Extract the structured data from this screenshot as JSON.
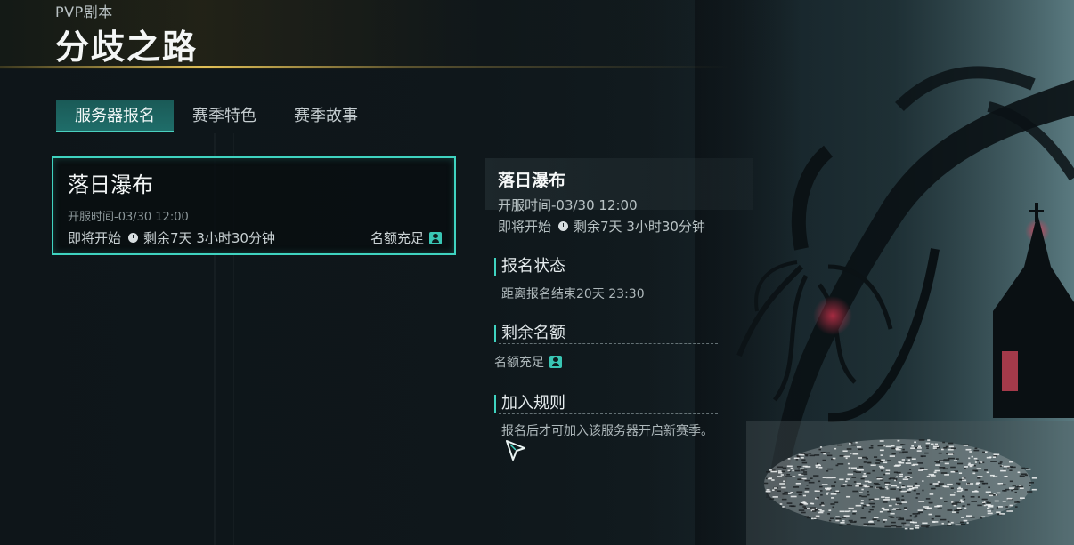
{
  "header": {
    "subtitle": "PVP剧本",
    "title": "分歧之路"
  },
  "tabs": [
    {
      "label": "服务器报名",
      "active": true
    },
    {
      "label": "赛季特色",
      "active": false
    },
    {
      "label": "赛季故事",
      "active": false
    }
  ],
  "server_card": {
    "name": "落日瀑布",
    "open_time": "开服时间-03/30 12:00",
    "status": "即将开始",
    "remaining": "剩余7天 3小时30分钟",
    "quota": "名额充足",
    "selected": true
  },
  "detail": {
    "name": "落日瀑布",
    "open_time": "开服时间-03/30 12:00",
    "status": "即将开始",
    "remaining": "剩余7天 3小时30分钟",
    "sections": [
      {
        "heading": "报名状态",
        "text": "距离报名结束20天 23:30"
      },
      {
        "heading": "剩余名额",
        "text": "名额充足"
      },
      {
        "heading": "加入规则",
        "text": "报名后才可加入该服务器开启新赛季。"
      }
    ]
  },
  "icons": {
    "clock": "clock-icon",
    "quota": "person-badge-icon",
    "cursor": "arrow-cursor-icon"
  },
  "colors": {
    "accent": "#3fd3c0",
    "tab_active_bg": "#1f6d69",
    "gold_line": "#ebc85a"
  }
}
